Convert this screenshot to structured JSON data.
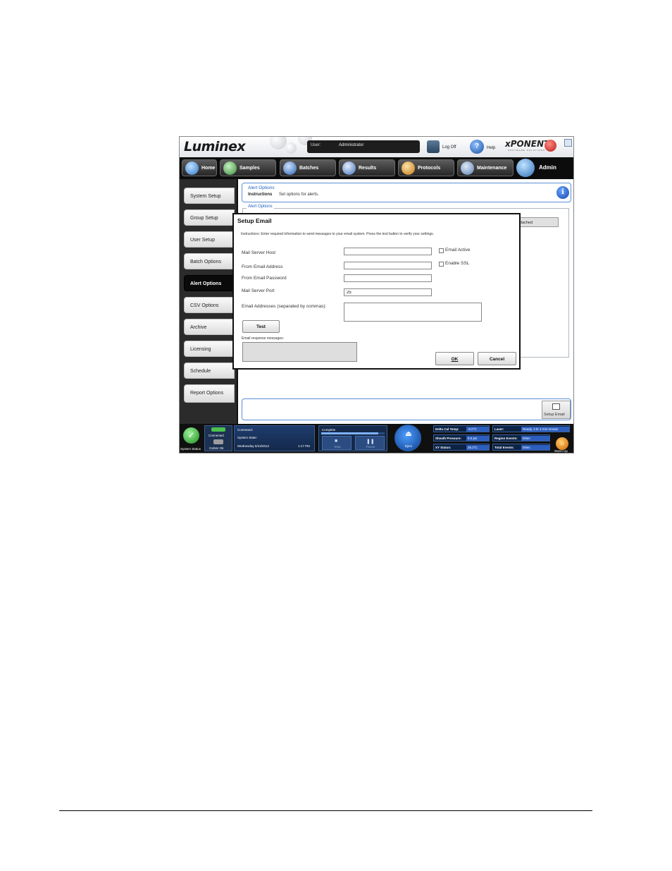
{
  "header": {
    "logo": "Luminex",
    "logo_tm": "®",
    "user_label": "User:",
    "user_value": "Administrator",
    "logoff_label": "Log Off",
    "help_label": "Help",
    "help_glyph": "?",
    "xponent_logo": "xPONENT",
    "xponent_sub": "SOFTWARE SOLUTIONS"
  },
  "nav": {
    "tabs": [
      {
        "label": "Home",
        "color": "#4a9be8"
      },
      {
        "label": "Samples",
        "color": "#5aa85a"
      },
      {
        "label": "Batches",
        "color": "#3a79c9"
      },
      {
        "label": "Results",
        "color": "#4a86d8"
      },
      {
        "label": "Protocols",
        "color": "#e8a030"
      },
      {
        "label": "Maintenance",
        "color": "#7aa0d0"
      }
    ],
    "admin_label": "Admin"
  },
  "sidebar": {
    "items": [
      {
        "label": "System Setup"
      },
      {
        "label": "Group Setup"
      },
      {
        "label": "User Setup"
      },
      {
        "label": "Batch Options"
      },
      {
        "label": "Alert Options"
      },
      {
        "label": "CSV Options"
      },
      {
        "label": "Archive"
      },
      {
        "label": "Licensing"
      },
      {
        "label": "Schedule"
      },
      {
        "label": "Report Options"
      }
    ],
    "active_index": 4
  },
  "content": {
    "title": "Alert Options",
    "instructions_label": "Instructions",
    "instructions_text": "Set options for alerts.",
    "info_glyph": "i",
    "group_legend": "Alert Options",
    "users_attached": "sers attached",
    "setup_email_label": "Setup Email"
  },
  "dialog": {
    "title": "Setup Email",
    "instructions": "Instructions: Enter required information to send messages to your email system. Press the test button to verify your settings.",
    "mail_server_host_label": "Mail Server Host",
    "mail_server_host_value": "",
    "from_email_address_label": "From Email Address",
    "from_email_address_value": "",
    "from_email_password_label": "From Email Password",
    "from_email_password_value": "",
    "mail_server_port_label": "Mail Server Port",
    "mail_server_port_value": "25",
    "email_addresses_label": "Email Addresses (separated by commas):",
    "email_active_label": "Email Active",
    "enable_ssl_label": "Enable SSL",
    "test_label": "Test",
    "response_label": "Email response messages:",
    "ok_label": "OK",
    "cancel_label": "Cancel"
  },
  "status": {
    "system_status_label": "System Status",
    "check_glyph": "✓",
    "connected_label": "Connected",
    "calver_label": "CalVer Ok",
    "command_label": "Command:",
    "system_state_label": "System State:",
    "date": "Wednesday 5/23/2012",
    "time": "1:17 PM",
    "progress_label": "Complete",
    "progress_value": 0.9,
    "stop_label": "Stop",
    "stop_glyph": "■",
    "pause_label": "Pause",
    "pause_glyph": "❚❚",
    "eject_label": "Eject",
    "eject_glyph": "⏏",
    "metrics_left": [
      {
        "name": "Delta Cal Temp:",
        "value": "-0.0°C"
      },
      {
        "name": "Sheath Pressure:",
        "value": "9.5 psi"
      },
      {
        "name": "XY Status:",
        "value": "25.3°C"
      }
    ],
    "metrics_right": [
      {
        "name": "Laser:",
        "value": "Ready, 3 hr 4 min remain"
      },
      {
        "name": "Region Events:",
        "value": "0/sec"
      },
      {
        "name": "Total Events:",
        "value": "0/sec"
      }
    ],
    "warmup_label": "Warm Up",
    "warmup_glyph": "☼"
  }
}
